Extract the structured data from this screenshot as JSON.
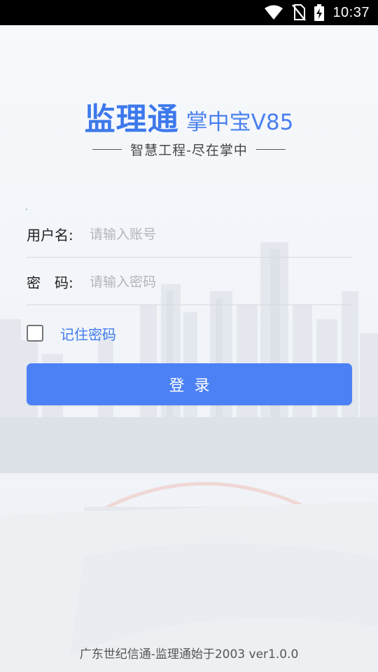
{
  "status_bar": {
    "time": "10:37",
    "icons": [
      "wifi-icon",
      "no-sim-icon",
      "battery-charging-icon"
    ]
  },
  "header": {
    "title_main": "监理通",
    "title_sub": "掌中宝V85",
    "slogan": "智慧工程-尽在掌中"
  },
  "form": {
    "username_label": "用户名:",
    "username_placeholder": "请输入账号",
    "username_value": "",
    "password_label": "密　码:",
    "password_placeholder": "请输入密码",
    "password_value": "",
    "remember_label": "记住密码",
    "remember_checked": false,
    "login_label": "登录"
  },
  "footer": {
    "text": "广东世纪信通-监理通始于2003 ver1.0.0"
  },
  "colors": {
    "accent": "#4b81f5",
    "title": "#3d79ec",
    "status_bar": "#000000"
  }
}
